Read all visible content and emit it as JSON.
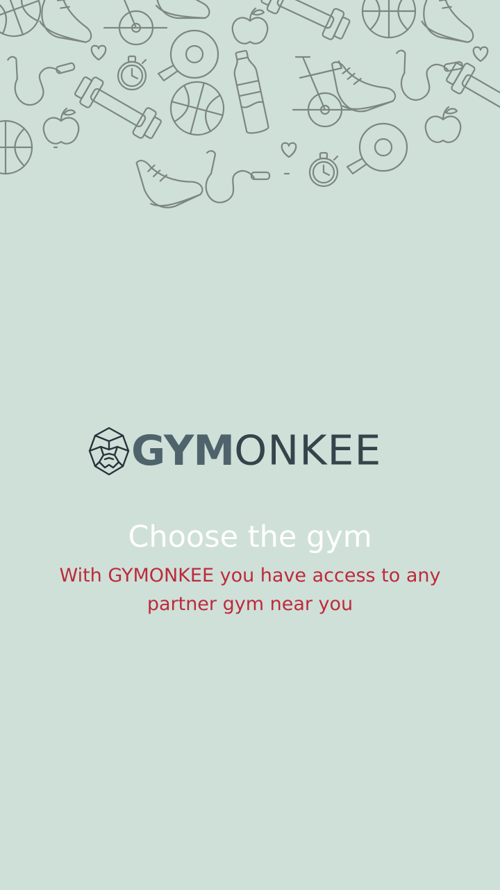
{
  "colors": {
    "background": "#cfe0d8",
    "doodle_stroke": "#7c8682",
    "logo_bold": "#4f636c",
    "logo_thin": "#35434b",
    "logo_mark": "#27333a",
    "headline": "#ffffff",
    "subline": "#bd2a3b"
  },
  "decoration": {
    "pattern_icons": [
      "basketball-icon",
      "dumbbell-icon",
      "sneaker-icon",
      "apple-icon",
      "jump-rope-icon",
      "stopwatch-icon",
      "ping-pong-paddle-icon",
      "water-bottle-icon",
      "exercise-bike-icon",
      "heart-icon"
    ]
  },
  "logo": {
    "mark_icon": "gorilla-head-icon",
    "bold_text": "GYM",
    "thin_text": "ONKEE"
  },
  "onboarding": {
    "title": "Choose the gym",
    "subtitle": "With GYMONKEE you have access to any partner gym near you"
  }
}
